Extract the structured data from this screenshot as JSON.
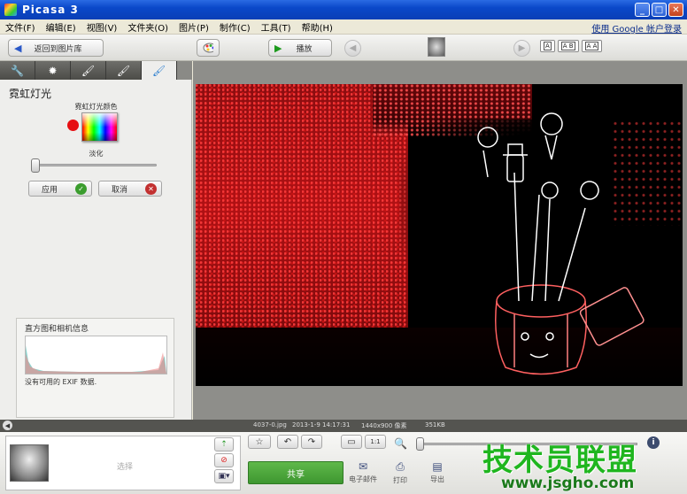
{
  "window": {
    "title": "Picasa 3"
  },
  "menu": {
    "items": [
      "文件(F)",
      "编辑(E)",
      "视图(V)",
      "文件夹(O)",
      "图片(P)",
      "制作(C)",
      "工具(T)",
      "帮助(H)"
    ],
    "signin": "使用 Google 帐户登录"
  },
  "toolbar": {
    "back_label": "返回到图片库",
    "play_label": "播放",
    "view_a": "A",
    "view_ab": "A B",
    "view_aa": "A A"
  },
  "panel": {
    "effect_title": "霓虹灯光",
    "color_label": "霓虹灯光颜色",
    "selected_color": "#e60f12",
    "fade_label": "淡化",
    "fade_value": 0,
    "apply_label": "应用",
    "cancel_label": "取消",
    "histogram_title": "直方图和相机信息",
    "exif_text": "没有可用的 EXIF 数据."
  },
  "infobar": {
    "filename": "4037-0.jpg",
    "datetime": "2013-1-9 14:17:31",
    "dimensions": "1440x900 像素",
    "filesize": "351KB"
  },
  "tray": {
    "select_label": "选择",
    "share_label": "共享",
    "email_label": "电子邮件",
    "print_label": "打印",
    "export_label": "导出",
    "ratio_label": "1:1"
  },
  "watermark": {
    "main": "技术员联盟",
    "sub": "www.jsgho.com"
  },
  "colors": {
    "accent_blue": "#0a48c9",
    "share_green": "#3e9730",
    "neon_red": "#e60f12"
  }
}
